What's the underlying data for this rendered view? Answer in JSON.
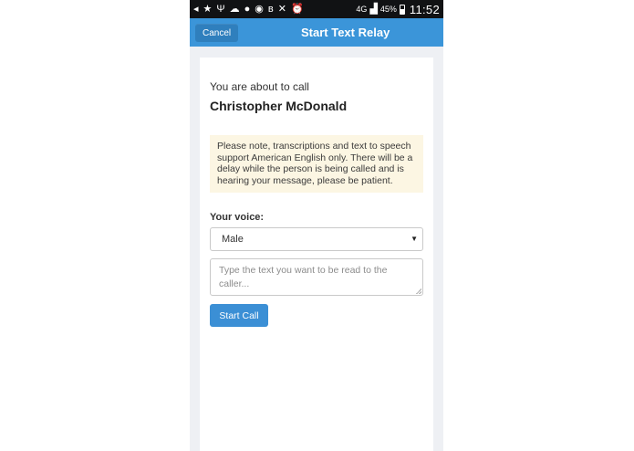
{
  "status_bar": {
    "icons": [
      "back-icon",
      "star-icon",
      "usb-icon",
      "cloud-upload-icon",
      "chat-icon",
      "soccer-icon",
      "bluetooth-icon",
      "mute-icon",
      "alarm-icon",
      "signal-icon"
    ],
    "network": "4G",
    "battery": "45%",
    "time": "11:52"
  },
  "header": {
    "cancel_label": "Cancel",
    "title": "Start Text Relay"
  },
  "main": {
    "intro": "You are about to call",
    "callee": "Christopher McDonald",
    "notice": "Please note, transcriptions and text to speech support American English only. There will be a delay while the person is being called and is hearing your message, please be patient.",
    "voice_label": "Your voice:",
    "voice_selected": "Male",
    "message_placeholder": "Type the text you want to be read to the caller...",
    "start_call_label": "Start Call"
  },
  "colors": {
    "accent": "#3b95d9",
    "notice_bg": "#fcf6e3"
  }
}
